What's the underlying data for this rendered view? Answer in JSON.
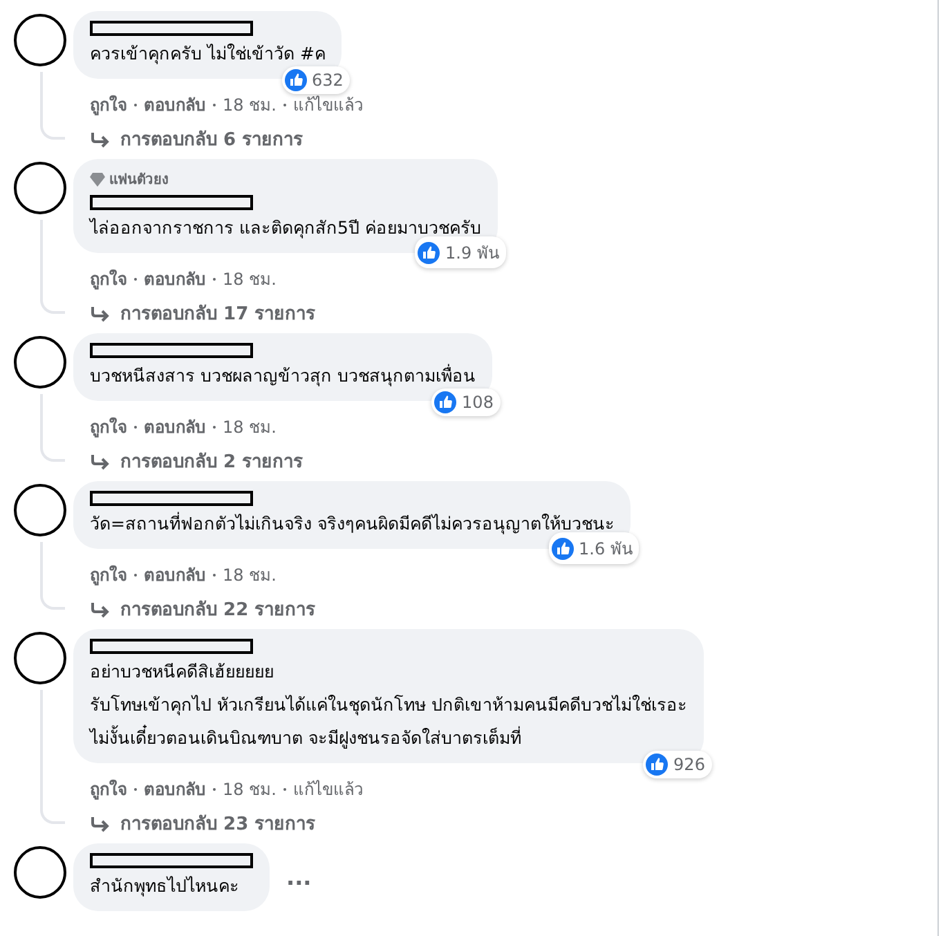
{
  "comments": [
    {
      "lines": [
        "ควรเข้าคุกครับ ไม่ใช่เข้าวัด #ค"
      ],
      "reactions": "632",
      "actions": [
        {
          "text": "ถูกใจ",
          "kind": "link"
        },
        {
          "text": "ตอบกลับ",
          "kind": "link"
        },
        {
          "text": "18 ชม.",
          "kind": "time"
        },
        {
          "text": "แก้ไขแล้ว",
          "kind": "note"
        }
      ],
      "replies": "การตอบกลับ 6 รายการ"
    },
    {
      "badge": "แฟนตัวยง",
      "lines": [
        "ไล่ออกจากราชการ และติดคุกสัก5ปี ค่อยมาบวชครับ"
      ],
      "reactions": "1.9 พัน",
      "actions": [
        {
          "text": "ถูกใจ",
          "kind": "link"
        },
        {
          "text": "ตอบกลับ",
          "kind": "link"
        },
        {
          "text": "18 ชม.",
          "kind": "time"
        }
      ],
      "replies": "การตอบกลับ 17 รายการ"
    },
    {
      "lines": [
        "บวชหนีสงสาร บวชผลาญข้าวสุก บวชสนุกตามเพื่อน"
      ],
      "reactions": "108",
      "actions": [
        {
          "text": "ถูกใจ",
          "kind": "link"
        },
        {
          "text": "ตอบกลับ",
          "kind": "link"
        },
        {
          "text": "18 ชม.",
          "kind": "time"
        }
      ],
      "replies": "การตอบกลับ 2 รายการ"
    },
    {
      "lines": [
        "วัด=สถานที่ฟอกตัวไม่เกินจริง จริงๆคนผิดมีคดีไม่ควรอนุญาตให้บวชนะ"
      ],
      "reactions": "1.6 พัน",
      "actions": [
        {
          "text": "ถูกใจ",
          "kind": "link"
        },
        {
          "text": "ตอบกลับ",
          "kind": "link"
        },
        {
          "text": "18 ชม.",
          "kind": "time"
        }
      ],
      "replies": "การตอบกลับ 22 รายการ"
    },
    {
      "lines": [
        "อย่าบวชหนีคดีสิเฮ้ยยยยย",
        "รับโทษเข้าคุกไป หัวเกรียนได้แค่ในชุดนักโทษ ปกติเขาห้ามคนมีคดีบวชไม่ใช่เรอะ",
        "ไม่งั้นเดี๋ยวตอนเดินบิณฑบาต จะมีฝูงชนรอจัดใส่บาตรเต็มที่"
      ],
      "reactions": "926",
      "actions": [
        {
          "text": "ถูกใจ",
          "kind": "link"
        },
        {
          "text": "ตอบกลับ",
          "kind": "link"
        },
        {
          "text": "18 ชม.",
          "kind": "time"
        },
        {
          "text": "แก้ไขแล้ว",
          "kind": "note"
        }
      ],
      "replies": "การตอบกลับ 23 รายการ"
    },
    {
      "lines": [
        "สำนักพุทธไปไหนคะ"
      ],
      "more": "..."
    }
  ]
}
